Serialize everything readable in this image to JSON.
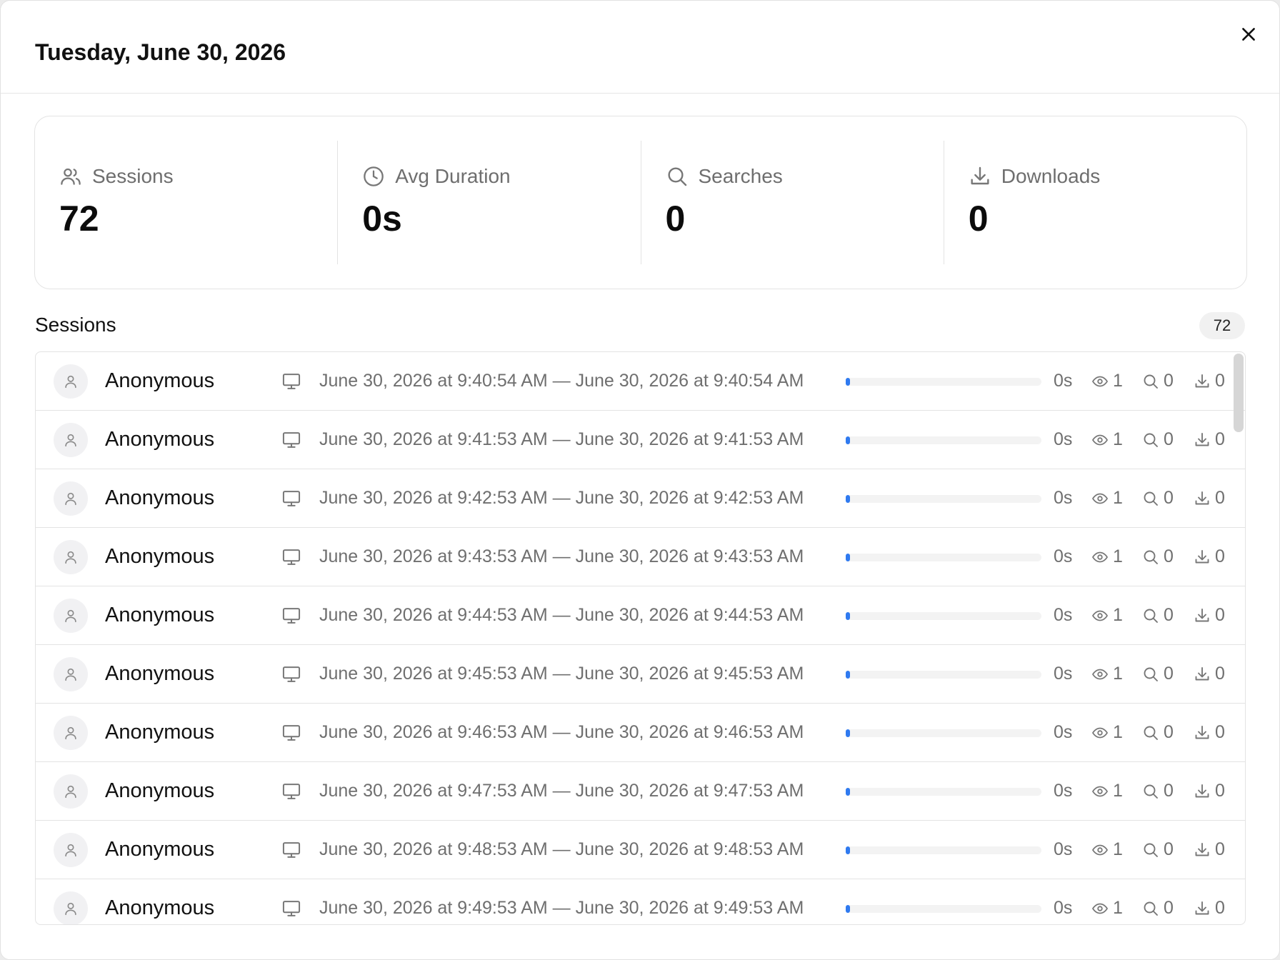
{
  "header": {
    "title": "Tuesday, June 30, 2026"
  },
  "stats": [
    {
      "label": "Sessions",
      "value": "72",
      "icon": "users-icon"
    },
    {
      "label": "Avg Duration",
      "value": "0s",
      "icon": "clock-icon"
    },
    {
      "label": "Searches",
      "value": "0",
      "icon": "search-icon"
    },
    {
      "label": "Downloads",
      "value": "0",
      "icon": "download-icon"
    }
  ],
  "sessions_section": {
    "title": "Sessions",
    "count": "72"
  },
  "colors": {
    "accent": "#2f7af0",
    "muted_text": "#6f6f6f",
    "border": "#e3e3e3"
  },
  "sessions": [
    {
      "user": "Anonymous",
      "range": "June 30, 2026 at 9:40:54 AM — June 30, 2026 at 9:40:54 AM",
      "progress": 0.02,
      "duration": "0s",
      "views": "1",
      "searches": "0",
      "downloads": "0"
    },
    {
      "user": "Anonymous",
      "range": "June 30, 2026 at 9:41:53 AM — June 30, 2026 at 9:41:53 AM",
      "progress": 0.02,
      "duration": "0s",
      "views": "1",
      "searches": "0",
      "downloads": "0"
    },
    {
      "user": "Anonymous",
      "range": "June 30, 2026 at 9:42:53 AM — June 30, 2026 at 9:42:53 AM",
      "progress": 0.02,
      "duration": "0s",
      "views": "1",
      "searches": "0",
      "downloads": "0"
    },
    {
      "user": "Anonymous",
      "range": "June 30, 2026 at 9:43:53 AM — June 30, 2026 at 9:43:53 AM",
      "progress": 0.02,
      "duration": "0s",
      "views": "1",
      "searches": "0",
      "downloads": "0"
    },
    {
      "user": "Anonymous",
      "range": "June 30, 2026 at 9:44:53 AM — June 30, 2026 at 9:44:53 AM",
      "progress": 0.02,
      "duration": "0s",
      "views": "1",
      "searches": "0",
      "downloads": "0"
    },
    {
      "user": "Anonymous",
      "range": "June 30, 2026 at 9:45:53 AM — June 30, 2026 at 9:45:53 AM",
      "progress": 0.02,
      "duration": "0s",
      "views": "1",
      "searches": "0",
      "downloads": "0"
    },
    {
      "user": "Anonymous",
      "range": "June 30, 2026 at 9:46:53 AM — June 30, 2026 at 9:46:53 AM",
      "progress": 0.02,
      "duration": "0s",
      "views": "1",
      "searches": "0",
      "downloads": "0"
    },
    {
      "user": "Anonymous",
      "range": "June 30, 2026 at 9:47:53 AM — June 30, 2026 at 9:47:53 AM",
      "progress": 0.02,
      "duration": "0s",
      "views": "1",
      "searches": "0",
      "downloads": "0"
    },
    {
      "user": "Anonymous",
      "range": "June 30, 2026 at 9:48:53 AM — June 30, 2026 at 9:48:53 AM",
      "progress": 0.02,
      "duration": "0s",
      "views": "1",
      "searches": "0",
      "downloads": "0"
    },
    {
      "user": "Anonymous",
      "range": "June 30, 2026 at 9:49:53 AM — June 30, 2026 at 9:49:53 AM",
      "progress": 0.02,
      "duration": "0s",
      "views": "1",
      "searches": "0",
      "downloads": "0"
    }
  ]
}
